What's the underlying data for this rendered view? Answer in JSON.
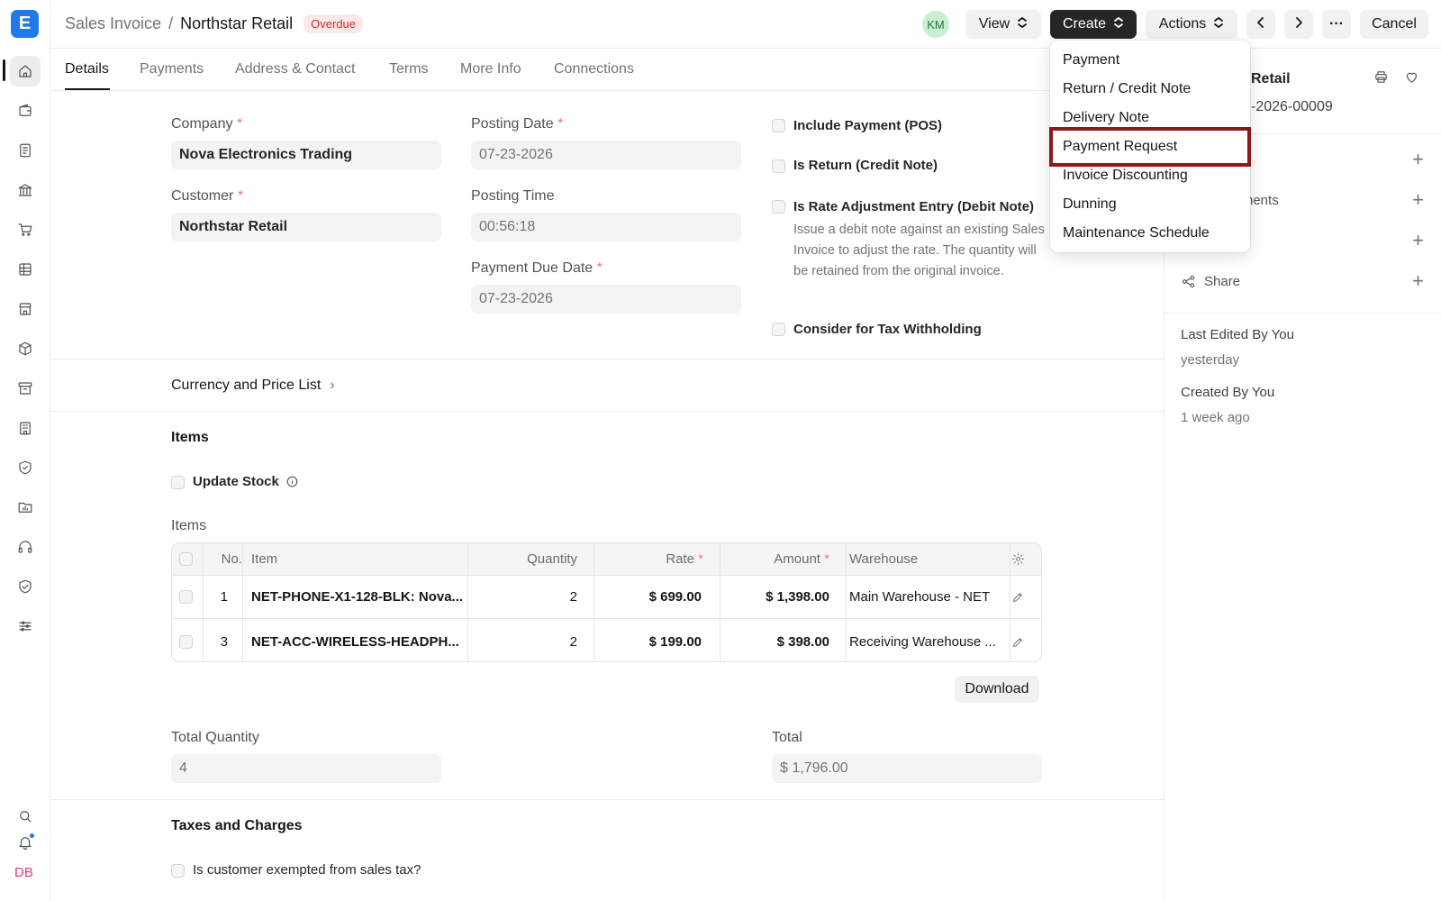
{
  "rail": {
    "logo_letter": "E",
    "user_initials": "DB",
    "icons": [
      "home-icon",
      "wallet-icon",
      "document-icon",
      "bank-icon",
      "cart-icon",
      "table-icon",
      "store-icon",
      "package-icon",
      "archive-icon",
      "building-icon",
      "shield-icon",
      "folder-chart-icon",
      "headset-icon",
      "handshake-shield-icon",
      "sliders-icon"
    ],
    "bottom_icons": [
      "search-icon",
      "bell-icon"
    ]
  },
  "header": {
    "breadcrumb_parent": "Sales Invoice",
    "separator": "/",
    "doc_title": "Northstar Retail",
    "status_badge": "Overdue",
    "avatar_initials": "KM",
    "view_label": "View",
    "create_label": "Create",
    "actions_label": "Actions",
    "more_label": "···",
    "cancel_label": "Cancel"
  },
  "tabs": [
    "Details",
    "Payments",
    "Address & Contact",
    "Terms",
    "More Info",
    "Connections"
  ],
  "form": {
    "company_label": "Company",
    "company_value": "Nova Electronics Trading",
    "customer_label": "Customer",
    "customer_value": "Northstar Retail",
    "posting_date_label": "Posting Date",
    "posting_date_value": "07-23-2026",
    "posting_time_label": "Posting Time",
    "posting_time_value": "00:56:18",
    "due_date_label": "Payment Due Date",
    "due_date_value": "07-23-2026",
    "required_mark": "*",
    "checkboxes": {
      "include_payment": "Include Payment (POS)",
      "is_return": "Is Return (Credit Note)",
      "rate_adjustment": "Is Rate Adjustment Entry (Debit Note)",
      "rate_adjustment_help": "Issue a debit note against an existing Sales Invoice to adjust the rate. The quantity will be retained from the original invoice.",
      "tax_withholding": "Consider for Tax Withholding"
    },
    "currency_section": "Currency and Price List",
    "items_section": "Items",
    "update_stock": "Update Stock",
    "items_table_label": "Items",
    "download_label": "Download",
    "total_qty_label": "Total Quantity",
    "total_qty_value": "4",
    "total_label": "Total",
    "total_value": "$ 1,796.00",
    "taxes_section": "Taxes and Charges",
    "tax_exempt": "Is customer exempted from sales tax?"
  },
  "items_table": {
    "columns": [
      "No.",
      "Item",
      "Quantity",
      "Rate",
      "Amount",
      "Warehouse"
    ],
    "rows": [
      {
        "no": "1",
        "item": "NET-PHONE-X1-128-BLK: Nova...",
        "qty": "2",
        "rate": "$ 699.00",
        "amount": "$ 1,398.00",
        "warehouse": "Main Warehouse - NET"
      },
      {
        "no": "3",
        "item": "NET-ACC-WIRELESS-HEADPH...",
        "qty": "2",
        "rate": "$ 199.00",
        "amount": "$ 398.00",
        "warehouse": "Receiving Warehouse ..."
      }
    ]
  },
  "sidebar": {
    "title_partial": "Retail",
    "subtitle_partial": "-2026-00009",
    "row2_partial": "nents",
    "share_label": "Share",
    "last_edited": "Last Edited By You",
    "last_edited_when": "yesterday",
    "created": "Created By You",
    "created_when": "1 week ago"
  },
  "create_menu": {
    "items": [
      "Payment",
      "Return / Credit Note",
      "Delivery Note",
      "Payment Request",
      "Invoice Discounting",
      "Dunning",
      "Maintenance Schedule"
    ],
    "highlighted": "Payment Request"
  },
  "colors": {
    "brand": "#1f7ae8",
    "overdue": "#c9302c",
    "highlight_border": "#8b1a1a"
  }
}
